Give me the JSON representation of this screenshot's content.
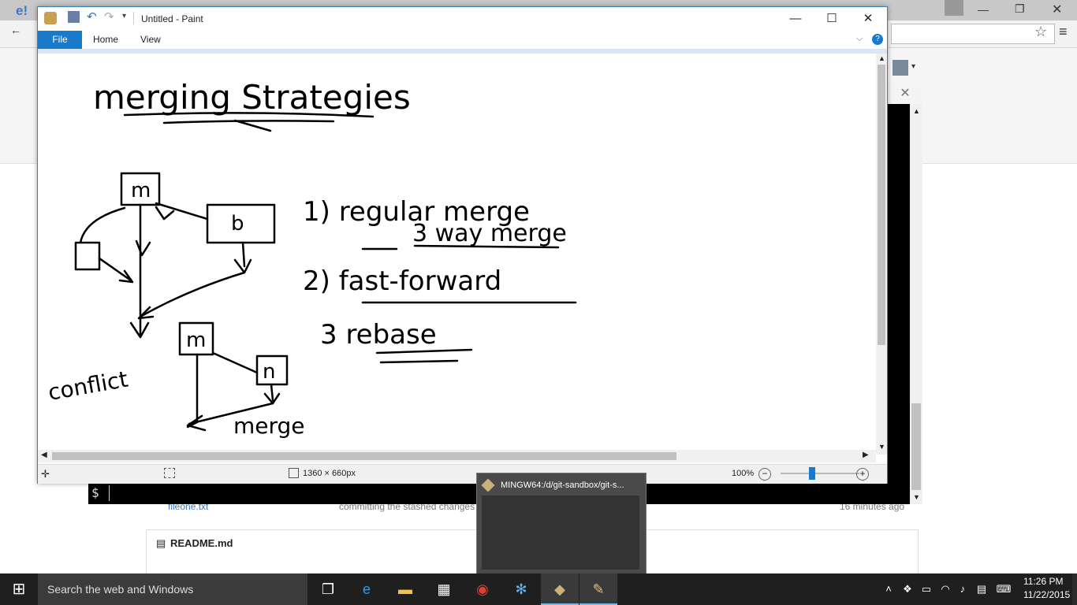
{
  "browser": {
    "logo_text": "e!",
    "back_icon": "back-arrow-icon",
    "star_icon": "star-icon",
    "menu_icon": "hamburger-icon",
    "user_icon": "user-icon"
  },
  "github_page": {
    "file_name": "fileone.txt",
    "commit_message": "committing the stashed changes",
    "commit_time": "16 minutes ago",
    "readme_title": "README.md"
  },
  "terminal": {
    "prompt": "$",
    "close_symbol": "✕"
  },
  "paint": {
    "title": "Untitled - Paint",
    "tabs": {
      "file": "File",
      "home": "Home",
      "view": "View"
    },
    "status": {
      "canvas_size": "1360 × 660px",
      "zoom": "100%"
    },
    "drawing": {
      "title": "merging Strategies",
      "item1": "1) regular merge",
      "item1_sub": "3 way merge",
      "item2": "2) fast-forward",
      "item3": "3  rebase",
      "node_m": "m",
      "node_b": "b",
      "node_m2": "m",
      "node_n": "n",
      "conflict": "conflict",
      "merge": "merge"
    }
  },
  "taskbar": {
    "search_placeholder": "Search the web and Windows",
    "preview_title": "MINGW64:/d/git-sandbox/git-s...",
    "time": "11:26 PM",
    "date": "11/22/2015"
  }
}
